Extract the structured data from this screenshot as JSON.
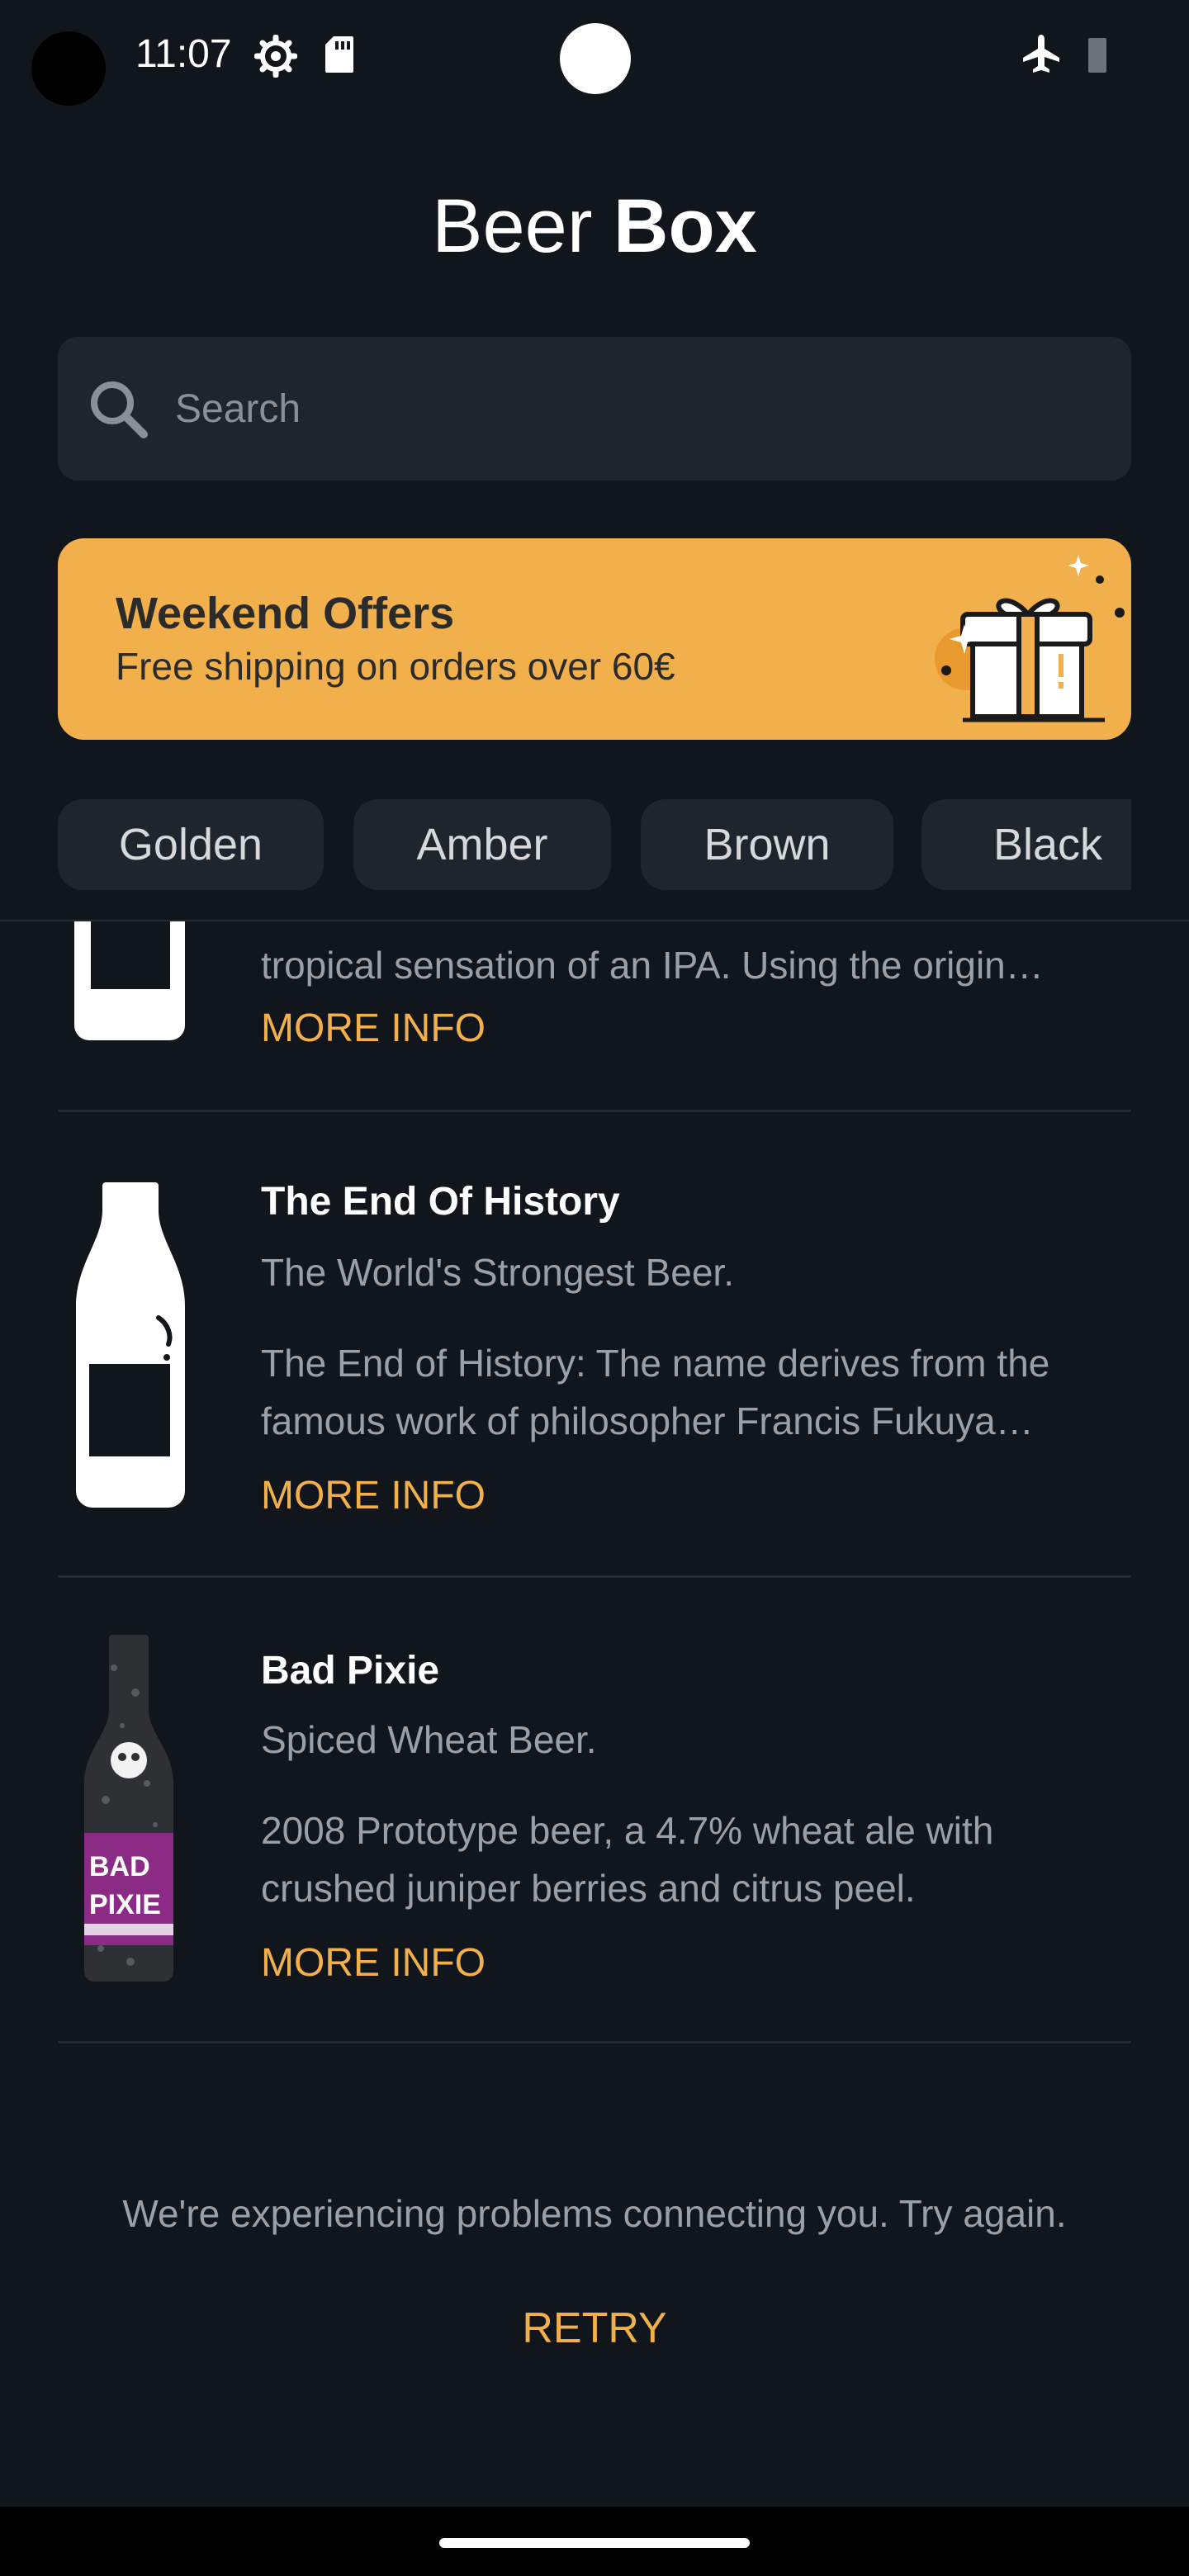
{
  "status_bar": {
    "time": "11:07",
    "icons": [
      "settings-icon",
      "sd-card-icon",
      "airplane-mode-icon",
      "battery-icon"
    ]
  },
  "header": {
    "title_light": "Beer ",
    "title_bold": "Box"
  },
  "search": {
    "placeholder": "Search",
    "value": ""
  },
  "banner": {
    "title": "Weekend Offers",
    "subtitle": "Free shipping on orders over 60€",
    "icon": "gift-icon"
  },
  "categories": [
    "Golden",
    "Amber",
    "Brown",
    "Black"
  ],
  "beers": [
    {
      "name": "",
      "tagline": "",
      "description": "tropical sensation of an IPA. Using the origin…",
      "more_info": "MORE INFO"
    },
    {
      "name": "The End Of History",
      "tagline": "The World's Strongest Beer.",
      "description": "The End of History: The name derives from the famous work of philosopher Francis Fukuya…",
      "more_info": "MORE INFO"
    },
    {
      "name": "Bad Pixie",
      "tagline": "Spiced Wheat Beer.",
      "description": "2008 Prototype beer, a 4.7% wheat ale with crushed juniper berries and citrus peel.",
      "more_info": "MORE INFO"
    }
  ],
  "error": {
    "message": "We're experiencing problems connecting you. Try again.",
    "retry_label": "RETRY"
  },
  "colors": {
    "background": "#10161b",
    "surface": "#1f252c",
    "accent": "#f2b04d",
    "muted_text": "#9aa0a6"
  }
}
